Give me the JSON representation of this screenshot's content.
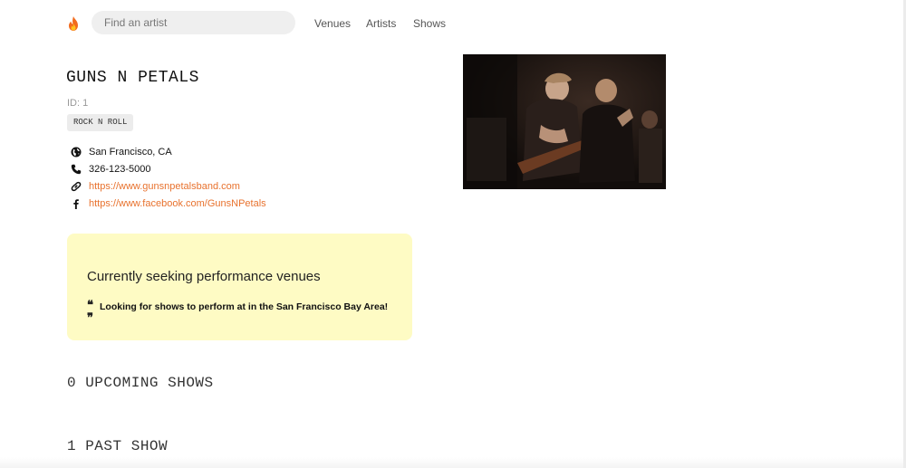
{
  "nav": {
    "logo_icon": "fire-icon",
    "search_placeholder": "Find an artist",
    "links": [
      "Venues",
      "Artists",
      "Shows"
    ]
  },
  "artist": {
    "name": "GUNS N PETALS",
    "id_label": "ID: 1",
    "genre": "ROCK N ROLL",
    "location": "San Francisco, CA",
    "phone": "326-123-5000",
    "website": "https://www.gunsnpetalsband.com",
    "facebook": "https://www.facebook.com/GunsNPetals",
    "icons": {
      "location": "globe-icon",
      "phone": "phone-icon",
      "website": "link-icon",
      "facebook": "facebook-icon"
    }
  },
  "seeking": {
    "heading": "Currently seeking performance venues",
    "description": "Looking for shows to perform at in the San Francisco Bay Area!"
  },
  "upcoming_shows": {
    "label": "0 UPCOMING SHOWS"
  },
  "past_shows": {
    "label": "1 PAST SHOW"
  },
  "colors": {
    "accent": "#e8722e",
    "seeking_bg": "#fefbc4",
    "search_bg": "#efefef"
  }
}
